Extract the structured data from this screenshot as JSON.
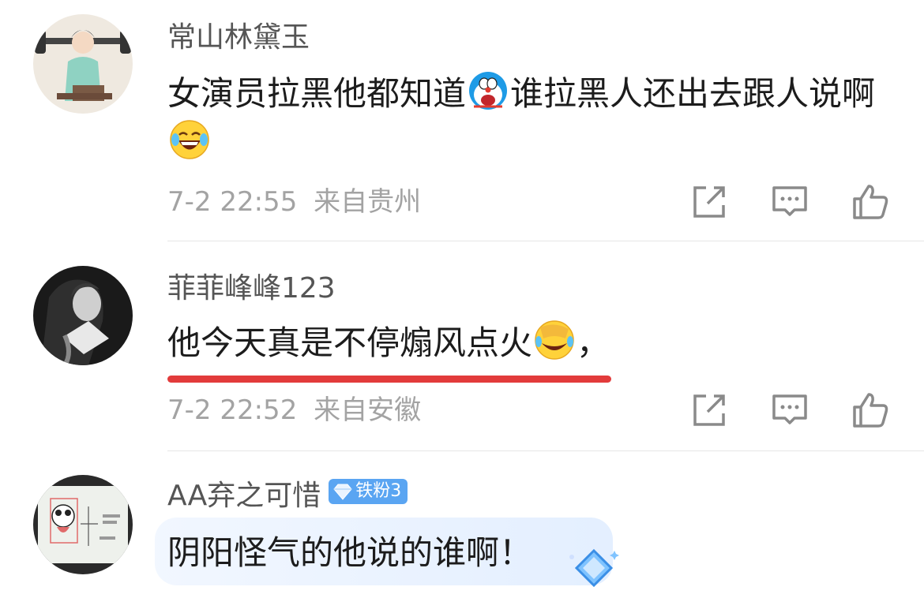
{
  "comments": [
    {
      "username": "常山林黛玉",
      "text_part1": "女演员拉黑他都知道",
      "emoji1": "doraemon-emoji",
      "text_part2": "谁拉黑人还出去跟人说啊",
      "emoji2": "laughing-tears-emoji",
      "time": "7-2 22:55",
      "location": "来自贵州"
    },
    {
      "username": "菲菲峰峰123",
      "text_part1": "他今天真是不停煽风点火",
      "emoji1": "face-palm-laughing-emoji",
      "text_part2": "，",
      "time": "7-2 22:52",
      "location": "来自安徽",
      "highlight_color": "#e23b3b"
    },
    {
      "username": "AA弃之可惜",
      "badge": "铁粉3",
      "text": "阴阳怪气的他说的谁啊！"
    }
  ],
  "actions": [
    "share-icon",
    "comment-icon",
    "like-icon"
  ],
  "colors": {
    "badge": "#5aa5f2",
    "meta": "#a3a3a3",
    "underline": "#e23b3b"
  }
}
